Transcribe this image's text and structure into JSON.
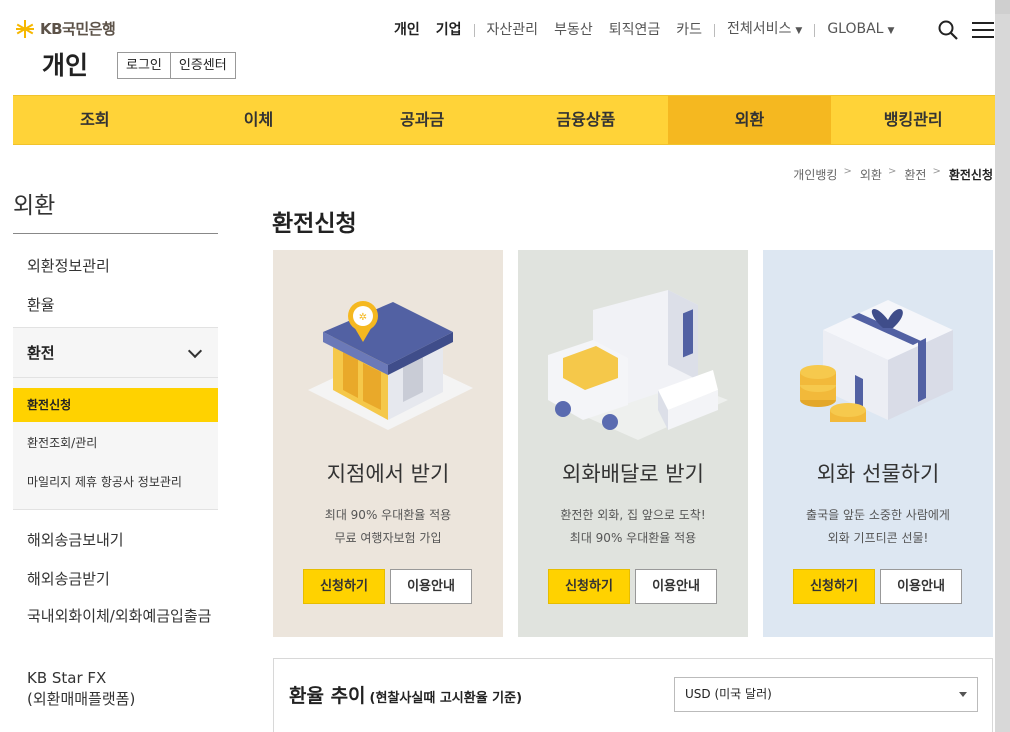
{
  "header": {
    "logo_text": "KB국민은행",
    "section_title": "개인",
    "login_label": "로그인",
    "cert_label": "인증센터"
  },
  "topnav": {
    "items": [
      "개인",
      "기업",
      "자산관리",
      "부동산",
      "퇴직연금",
      "카드",
      "전체서비스",
      "GLOBAL"
    ]
  },
  "gnb": {
    "tabs": [
      "조회",
      "이체",
      "공과금",
      "금융상품",
      "외환",
      "뱅킹관리"
    ],
    "active": "외환"
  },
  "breadcrumb": [
    "개인뱅킹",
    "외환",
    "환전",
    "환전신청"
  ],
  "sidebar": {
    "title": "외환",
    "items_top": [
      "외환정보관리",
      "환율"
    ],
    "group": {
      "label": "환전",
      "subs": [
        "환전신청",
        "환전조회/관리",
        "마일리지 제휴 항공사 정보관리"
      ]
    },
    "items_bottom": [
      "해외송금보내기",
      "해외송금받기",
      "국내외화이체/외화예금입출금",
      "KB Star FX\n(외환매매플랫폼)"
    ]
  },
  "page_heading": "환전신청",
  "cards": [
    {
      "title": "지점에서 받기",
      "desc1": "최대 90% 우대환율 적용",
      "desc2": "무료 여행자보험 가입",
      "apply": "신청하기",
      "guide": "이용안내",
      "bg": "#ece5dc"
    },
    {
      "title": "외화배달로 받기",
      "desc1": "환전한 외화, 집 앞으로 도착!",
      "desc2": "최대 90% 우대환율 적용",
      "apply": "신청하기",
      "guide": "이용안내",
      "bg": "#e0e3de"
    },
    {
      "title": "외화 선물하기",
      "desc1": "출국을 앞둔 소중한 사람에게",
      "desc2": "외화 기프티콘 선물!",
      "apply": "신청하기",
      "guide": "이용안내",
      "bg": "#dde7f2"
    }
  ],
  "rate": {
    "title": "환율 추이",
    "subtitle": "(현찰사실때 고시환율 기준)",
    "selected_currency": "USD (미국 달러)"
  },
  "colors": {
    "brand_yellow": "#ffd338",
    "active_tab": "#f5b820",
    "button_yellow": "#ffd200"
  }
}
